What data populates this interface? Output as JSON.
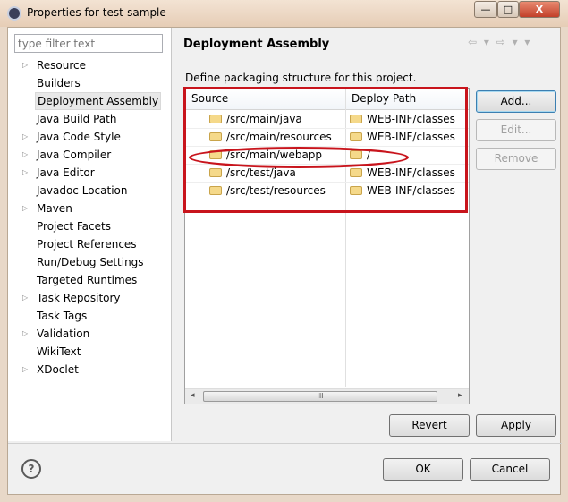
{
  "window": {
    "title": "Properties for test-sample",
    "min": "—",
    "max": "□",
    "close": "X"
  },
  "filter": {
    "placeholder": "type filter text"
  },
  "tree": [
    {
      "label": "Resource",
      "expandable": true
    },
    {
      "label": "Builders",
      "expandable": false
    },
    {
      "label": "Deployment Assembly",
      "expandable": false,
      "selected": true
    },
    {
      "label": "Java Build Path",
      "expandable": false
    },
    {
      "label": "Java Code Style",
      "expandable": true
    },
    {
      "label": "Java Compiler",
      "expandable": true
    },
    {
      "label": "Java Editor",
      "expandable": true
    },
    {
      "label": "Javadoc Location",
      "expandable": false
    },
    {
      "label": "Maven",
      "expandable": true
    },
    {
      "label": "Project Facets",
      "expandable": false
    },
    {
      "label": "Project References",
      "expandable": false
    },
    {
      "label": "Run/Debug Settings",
      "expandable": false
    },
    {
      "label": "Targeted Runtimes",
      "expandable": false
    },
    {
      "label": "Task Repository",
      "expandable": true
    },
    {
      "label": "Task Tags",
      "expandable": false
    },
    {
      "label": "Validation",
      "expandable": true
    },
    {
      "label": "WikiText",
      "expandable": false
    },
    {
      "label": "XDoclet",
      "expandable": true
    }
  ],
  "page": {
    "title": "Deployment Assembly",
    "nav_icons": "⇦ ▾ ⇨ ▾ ▾",
    "description": "Define packaging structure for this project."
  },
  "table": {
    "headers": [
      "Source",
      "Deploy Path"
    ],
    "rows": [
      [
        "/src/main/java",
        "WEB-INF/classes"
      ],
      [
        "/src/main/resources",
        "WEB-INF/classes"
      ],
      [
        "/src/main/webapp",
        "/"
      ],
      [
        "/src/test/java",
        "WEB-INF/classes"
      ],
      [
        "/src/test/resources",
        "WEB-INF/classes"
      ]
    ],
    "scroll_left": "◂",
    "scroll_right": "▸",
    "scroll_grip": "III"
  },
  "buttons": {
    "add": "Add...",
    "edit": "Edit...",
    "remove": "Remove",
    "revert": "Revert",
    "apply": "Apply",
    "ok": "OK",
    "cancel": "Cancel",
    "help": "?"
  },
  "colors": {
    "annotation": "#c8141c"
  }
}
